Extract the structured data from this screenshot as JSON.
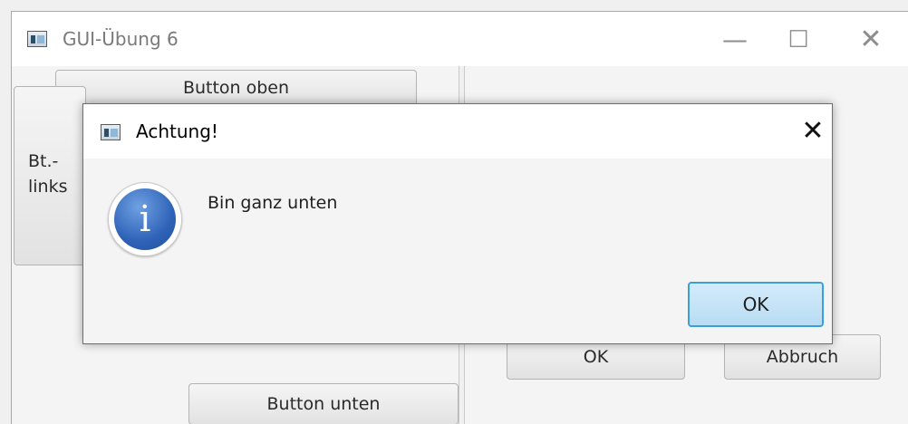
{
  "main_window": {
    "title": "GUI-Übung 6",
    "controls": {
      "minimize": "—",
      "maximize": "☐",
      "close": "✕"
    },
    "buttons": {
      "top": "Button oben",
      "left_line1": "Bt.-",
      "left_line2": "links",
      "bottom": "Button unten",
      "ok": "OK",
      "cancel": "Abbruch"
    }
  },
  "dialog": {
    "title": "Achtung!",
    "close": "✕",
    "icon": "info-icon",
    "icon_glyph": "i",
    "message": "Bin ganz unten",
    "ok_label": "OK"
  },
  "colors": {
    "info_blue": "#2f63b8",
    "default_button_border": "#3c9fd9",
    "default_button_fill": "#c6e4f7"
  }
}
